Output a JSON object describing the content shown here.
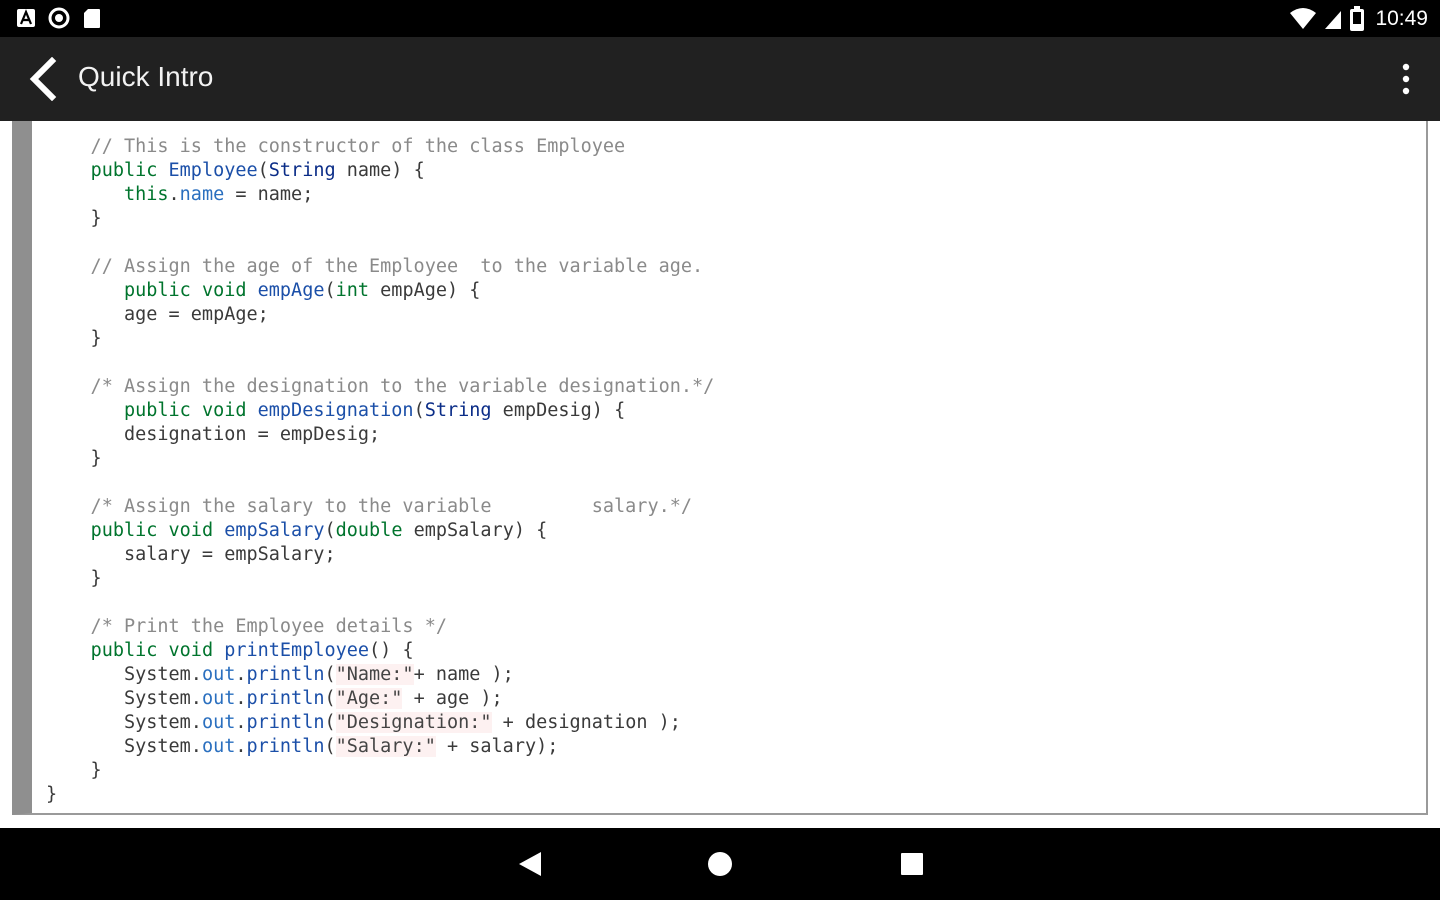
{
  "status_bar": {
    "time": "10:49",
    "left_icons": [
      "a-notification-icon",
      "circle-notification-icon",
      "sd-card-icon"
    ],
    "right_icons": [
      "wifi-icon",
      "cell-signal-icon",
      "battery-icon"
    ]
  },
  "app_bar": {
    "title": "Quick Intro",
    "back_icon": "chevron-left-icon",
    "overflow_icon": "more-vert-icon"
  },
  "code": {
    "lines": [
      {
        "t": "    // This is the constructor of the class Employee",
        "c": "cmt"
      },
      {
        "t": "    public Employee(String name) {",
        "c": "mixed"
      },
      {
        "t": "       this.name = name;",
        "c": "mixed"
      },
      {
        "t": "    }",
        "c": "plain"
      },
      {
        "t": "",
        "c": "plain"
      },
      {
        "t": "    // Assign the age of the Employee  to the variable age.",
        "c": "cmt"
      },
      {
        "t": "       public void empAge(int empAge) {",
        "c": "mixed"
      },
      {
        "t": "       age = empAge;",
        "c": "plain"
      },
      {
        "t": "    }",
        "c": "plain"
      },
      {
        "t": "",
        "c": "plain"
      },
      {
        "t": "    /* Assign the designation to the variable designation.*/",
        "c": "cmt"
      },
      {
        "t": "       public void empDesignation(String empDesig) {",
        "c": "mixed"
      },
      {
        "t": "       designation = empDesig;",
        "c": "plain"
      },
      {
        "t": "    }",
        "c": "plain"
      },
      {
        "t": "",
        "c": "plain"
      },
      {
        "t": "    /* Assign the salary to the variable         salary.*/",
        "c": "cmt"
      },
      {
        "t": "    public void empSalary(double empSalary) {",
        "c": "mixed"
      },
      {
        "t": "       salary = empSalary;",
        "c": "plain"
      },
      {
        "t": "    }",
        "c": "plain"
      },
      {
        "t": "",
        "c": "plain"
      },
      {
        "t": "    /* Print the Employee details */",
        "c": "cmt"
      },
      {
        "t": "    public void printEmployee() {",
        "c": "mixed"
      },
      {
        "t": "       System.out.println(\"Name:\"+ name );",
        "c": "mixed"
      },
      {
        "t": "       System.out.println(\"Age:\" + age );",
        "c": "mixed"
      },
      {
        "t": "       System.out.println(\"Designation:\" + designation );",
        "c": "mixed"
      },
      {
        "t": "       System.out.println(\"Salary:\" + salary);",
        "c": "mixed"
      },
      {
        "t": "    }",
        "c": "plain"
      },
      {
        "t": "}",
        "c": "plain"
      }
    ]
  },
  "nav_bar": {
    "back_icon": "nav-back-triangle-icon",
    "home_icon": "nav-home-circle-icon",
    "recents_icon": "nav-recents-square-icon"
  },
  "colors": {
    "status_bar_bg": "#000000",
    "app_bar_bg": "#212121",
    "keyword": "#00742d",
    "function": "#1b4fa8",
    "comment": "#8a8a8a",
    "gutter": "#8f8f8f"
  }
}
